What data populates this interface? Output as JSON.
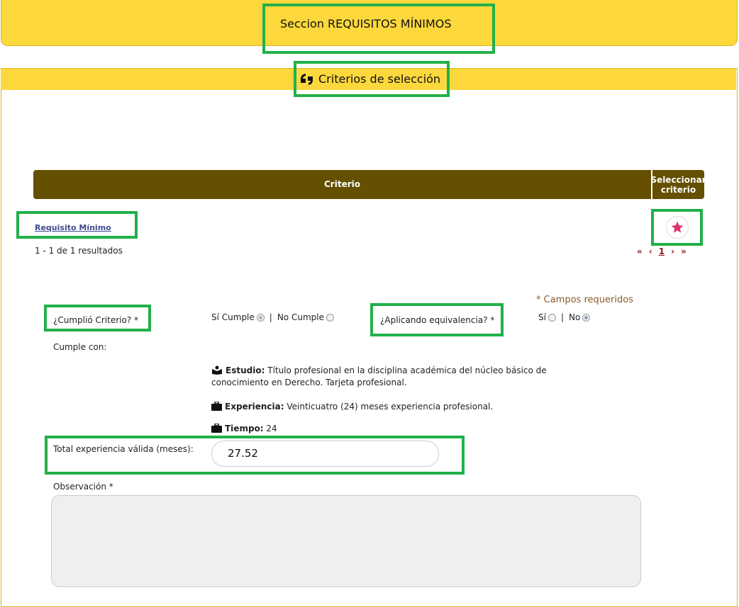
{
  "header": {
    "title": "Seccion REQUISITOS MÍNIMOS"
  },
  "panel": {
    "title": "Criterios de selección",
    "title_icon": "quote-icon"
  },
  "table": {
    "col_criterio": "Criterio",
    "col_seleccionar_line1": "Seleccionar",
    "col_seleccionar_line2": "criterio",
    "row_link": "Requisito Mínimo",
    "select_icon": "star-icon"
  },
  "results_text": "1 - 1 de 1 resultados",
  "pager": {
    "first": "«",
    "prev": "‹",
    "current": "1",
    "next": "›",
    "last": "»"
  },
  "form": {
    "required_note": "* Campos requeridos",
    "cumplio_label": "¿Cumplió Criterio? *",
    "si_cumple": "Sí Cumple",
    "separator": "|",
    "no_cumple": "No Cumple",
    "equivalencia_label": "¿Aplicando equivalencia? *",
    "si": "Sí",
    "no": "No",
    "cumple_con": "Cumple con:",
    "estudio_label": "Estudio:",
    "estudio_text": "Título profesional en la disciplina académica del núcleo básico de conocimiento en Derecho. Tarjeta profesional.",
    "experiencia_label": "Experiencia:",
    "experiencia_text": "Veinticuatro (24) meses experiencia profesional.",
    "tiempo_label": "Tiempo:",
    "tiempo_value": "24",
    "total_label": "Total experiencia válida (meses):",
    "total_value": "27.52",
    "observacion_label": "Observación *",
    "observacion_value": ""
  },
  "colors": {
    "banner": "#fdd83c",
    "table_header": "#654f00",
    "highlight": "#22b04a",
    "star": "#e0336e"
  }
}
